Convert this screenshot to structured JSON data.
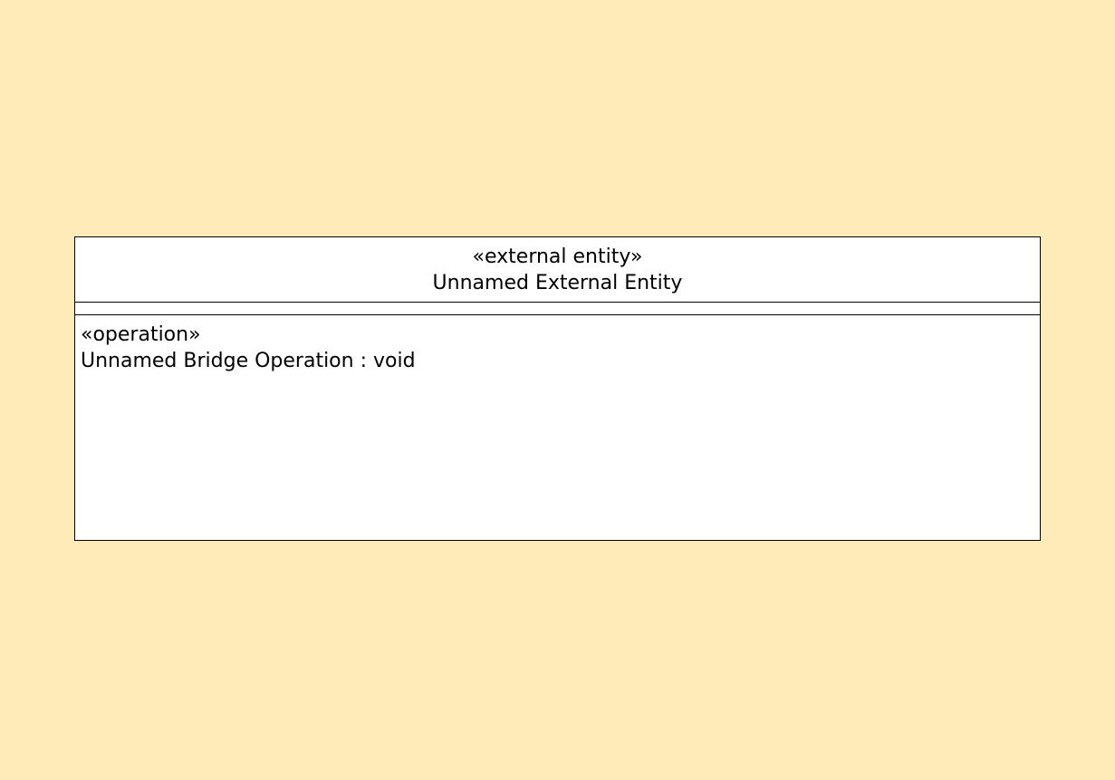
{
  "entity": {
    "stereotype": "«external entity»",
    "name": "Unnamed External Entity",
    "operations": [
      {
        "stereotype": "«operation»",
        "signature": "Unnamed Bridge Operation : void"
      }
    ]
  },
  "colors": {
    "canvas_background": "#ffebb8",
    "box_fill": "#ffffff",
    "box_stroke": "#000000"
  }
}
